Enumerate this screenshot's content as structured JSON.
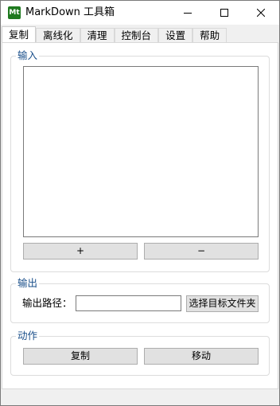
{
  "window": {
    "title": "MarkDown 工具箱",
    "icon_text": "Mt",
    "icon_color": "#1f7a1f"
  },
  "tabs": [
    {
      "label": "复制",
      "active": true
    },
    {
      "label": "离线化"
    },
    {
      "label": "清理"
    },
    {
      "label": "控制台"
    },
    {
      "label": "设置"
    },
    {
      "label": "帮助"
    }
  ],
  "input_group": {
    "legend": "输入",
    "add_label": "+",
    "remove_label": "−"
  },
  "output_group": {
    "legend": "输出",
    "path_label": "输出路径：",
    "path_value": "",
    "choose_button": "选择目标文件夹"
  },
  "action_group": {
    "legend": "动作",
    "copy_button": "复制",
    "move_button": "移动"
  },
  "colors": {
    "accent_text": "#1a4f8a",
    "button_bg": "#e1e1e1"
  }
}
